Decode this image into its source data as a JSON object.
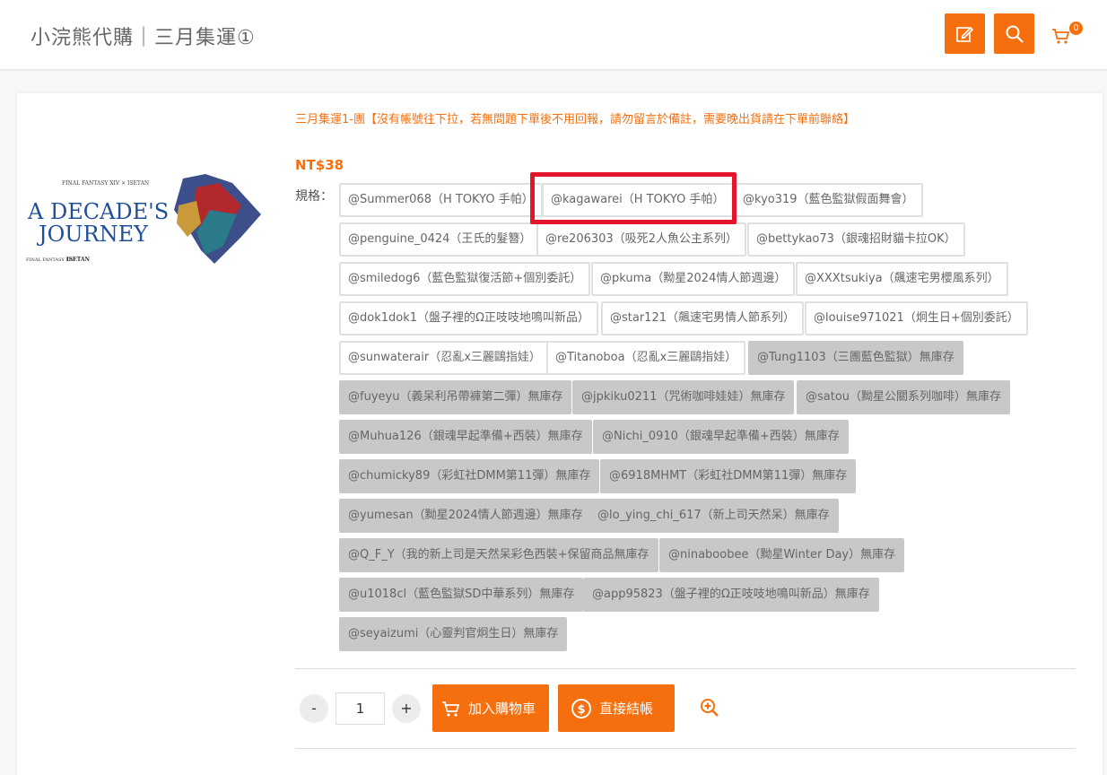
{
  "header": {
    "site_title": "小浣熊代購｜三月集運①",
    "cart_count": "0",
    "accent_color": "#f56f0e"
  },
  "product": {
    "title": "三月集運1-團【沒有帳號往下拉，若無問題下單後不用回報，請勿留言於備註，需要晚出貨請在下單前聯絡】",
    "price": "NT$38",
    "spec_label": "規格：",
    "image_text": {
      "top": "FINAL FANTASY XIV × ISETAN",
      "main_line1": "A DECADE'S",
      "main_line2": "JOURNEY",
      "footer_left": "FINAL FANTASY XIV",
      "footer_right": "ISETAN"
    },
    "options": [
      {
        "label": "@Summer068（H TOKYO 手帕）",
        "available": true
      },
      {
        "label": "@kagawarei（H TOKYO 手帕）",
        "available": true,
        "highlighted": true
      },
      {
        "label": "@kyo319（藍色監獄假面舞會）",
        "available": true
      },
      {
        "label": "@penguine_0424（王氏的髮簪）",
        "available": true
      },
      {
        "label": "@re206303（吸死2人魚公主系列）",
        "available": true
      },
      {
        "label": "@bettykao73（銀魂招財貓卡拉OK）",
        "available": true
      },
      {
        "label": "@smiledog6（藍色監獄復活節+個別委託）",
        "available": true
      },
      {
        "label": "@pkuma（黝星2024情人節週邊）",
        "available": true
      },
      {
        "label": "@XXXtsukiya（飆速宅男櫻風系列）",
        "available": true
      },
      {
        "label": "@dok1dok1（盤子裡的Ω正吱吱地鳴叫新品）",
        "available": true
      },
      {
        "label": "@star121（飆速宅男情人節系列）",
        "available": true
      },
      {
        "label": "@louise971021（炯生日+個別委託）",
        "available": true
      },
      {
        "label": "@sunwaterair（忍亂x三麗鷗指娃）",
        "available": true
      },
      {
        "label": "@Titanoboa（忍亂x三麗鷗指娃）",
        "available": true
      },
      {
        "label": "@Tung1103（三團藍色監獄）無庫存",
        "available": false
      },
      {
        "label": "@fuyeyu（義呆利吊帶褲第二彈）無庫存",
        "available": false
      },
      {
        "label": "@jpkiku0211（咒術咖啡娃娃）無庫存",
        "available": false
      },
      {
        "label": "@satou（黝星公關系列咖啡）無庫存",
        "available": false
      },
      {
        "label": "@Muhua126（銀魂早起準備+西裝）無庫存",
        "available": false
      },
      {
        "label": "@Nichi_0910（銀魂早起準備+西裝）無庫存",
        "available": false
      },
      {
        "label": "@chumicky89（彩虹社DMM第11彈）無庫存",
        "available": false
      },
      {
        "label": "@6918MHMT（彩虹社DMM第11彈）無庫存",
        "available": false
      },
      {
        "label": "@yumesan（黝星2024情人節週邊）無庫存",
        "available": false
      },
      {
        "label": "@lo_ying_chi_617（新上司天然呆）無庫存",
        "available": false
      },
      {
        "label": "@Q_F_Y（我的新上司是天然呆彩色西裝+保留商品無庫存",
        "available": false
      },
      {
        "label": "@ninaboobee（黝星Winter Day）無庫存",
        "available": false
      },
      {
        "label": "@u1018cl（藍色監獄SD中華系列）無庫存",
        "available": false
      },
      {
        "label": "@app95823（盤子裡的Ω正吱吱地鳴叫新品）無庫存",
        "available": false
      },
      {
        "label": "@seyaizumi（心靈判官炯生日）無庫存",
        "available": false
      }
    ]
  },
  "purchase": {
    "minus": "-",
    "plus": "+",
    "quantity": "1",
    "add_to_cart": "加入購物車",
    "checkout": "直接結帳"
  }
}
